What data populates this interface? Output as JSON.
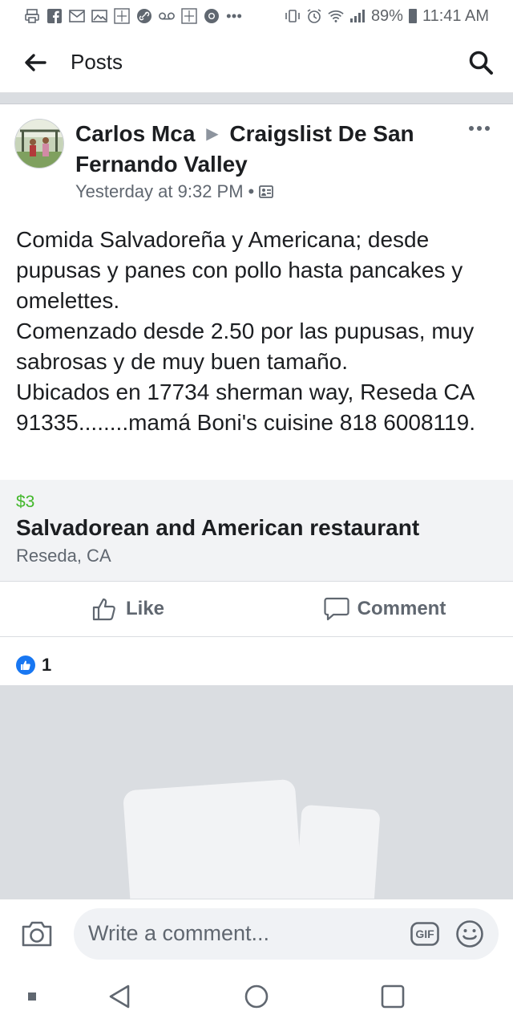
{
  "status_bar": {
    "notification_icons": [
      "printer-icon",
      "facebook-icon",
      "gmail-icon",
      "photos-icon",
      "dazn-icon",
      "link-icon",
      "voicemail-icon",
      "dazn-icon",
      "chrome-icon",
      "more-dots-icon"
    ],
    "right_icons": [
      "vibrate-icon",
      "alarm-icon",
      "wifi-icon",
      "signal-icon"
    ],
    "battery": "89%",
    "time": "11:41 AM"
  },
  "header": {
    "title": "Posts",
    "back_icon": "arrow-left-icon",
    "search_icon": "search-icon"
  },
  "post": {
    "author": "Carlos Mca",
    "group": "Craigslist De San Fernando Valley",
    "timestamp": "Yesterday at 9:32 PM",
    "separator": "•",
    "privacy_icon": "group-privacy-icon",
    "body": [
      "Comida Salvadoreña y Americana; desde pupusas y panes con pollo hasta pancakes y omelettes.",
      "Comenzado desde 2.50 por las pupusas, muy sabrosas y de muy buen tamaño.",
      "Ubicados en 17734 sherman way, Reseda CA 91335........mamá Boni's cuisine 818 6008119."
    ]
  },
  "listing": {
    "price": "$3",
    "title": "Salvadorean and American restaurant",
    "location": "Reseda, CA"
  },
  "actions": {
    "like": "Like",
    "comment": "Comment"
  },
  "reactions": {
    "count": "1"
  },
  "comment_bar": {
    "placeholder": "Write a comment...",
    "gif_label": "GIF"
  },
  "colors": {
    "accent": "#1877f2",
    "price": "#42b72a",
    "muted": "#606770"
  }
}
